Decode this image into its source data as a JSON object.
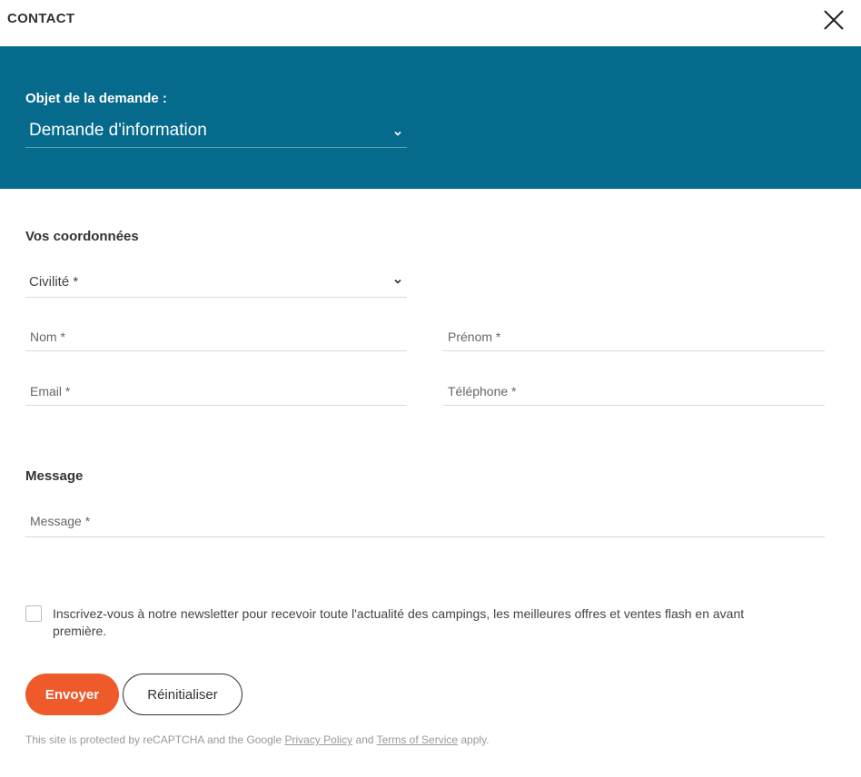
{
  "header": {
    "title": "CONTACT"
  },
  "request": {
    "label": "Objet de la demande :",
    "selected": "Demande d'information"
  },
  "coordinates": {
    "title": "Vos coordonnées",
    "civility": "Civilité *",
    "last_name_placeholder": "Nom *",
    "first_name_placeholder": "Prénom *",
    "email_placeholder": "Email *",
    "phone_placeholder": "Téléphone *"
  },
  "message": {
    "title": "Message",
    "placeholder": "Message *"
  },
  "newsletter": {
    "checked": false,
    "label": "Inscrivez-vous à notre newsletter pour recevoir toute l'actualité des campings, les meilleures offres et ventes flash en avant première."
  },
  "actions": {
    "send_label": "Envoyer",
    "reset_label": "Réinitialiser"
  },
  "recaptcha": {
    "prefix": "This site is protected by reCAPTCHA and the Google",
    "privacy_link": "Privacy Policy",
    "and": "and",
    "terms_link": "Terms of Service",
    "suffix": "apply."
  },
  "colors": {
    "band": "#056a8c",
    "send_button": "#ee5a2a"
  },
  "icons": {
    "close": "close-icon",
    "chevron": "chevron-down-icon"
  }
}
